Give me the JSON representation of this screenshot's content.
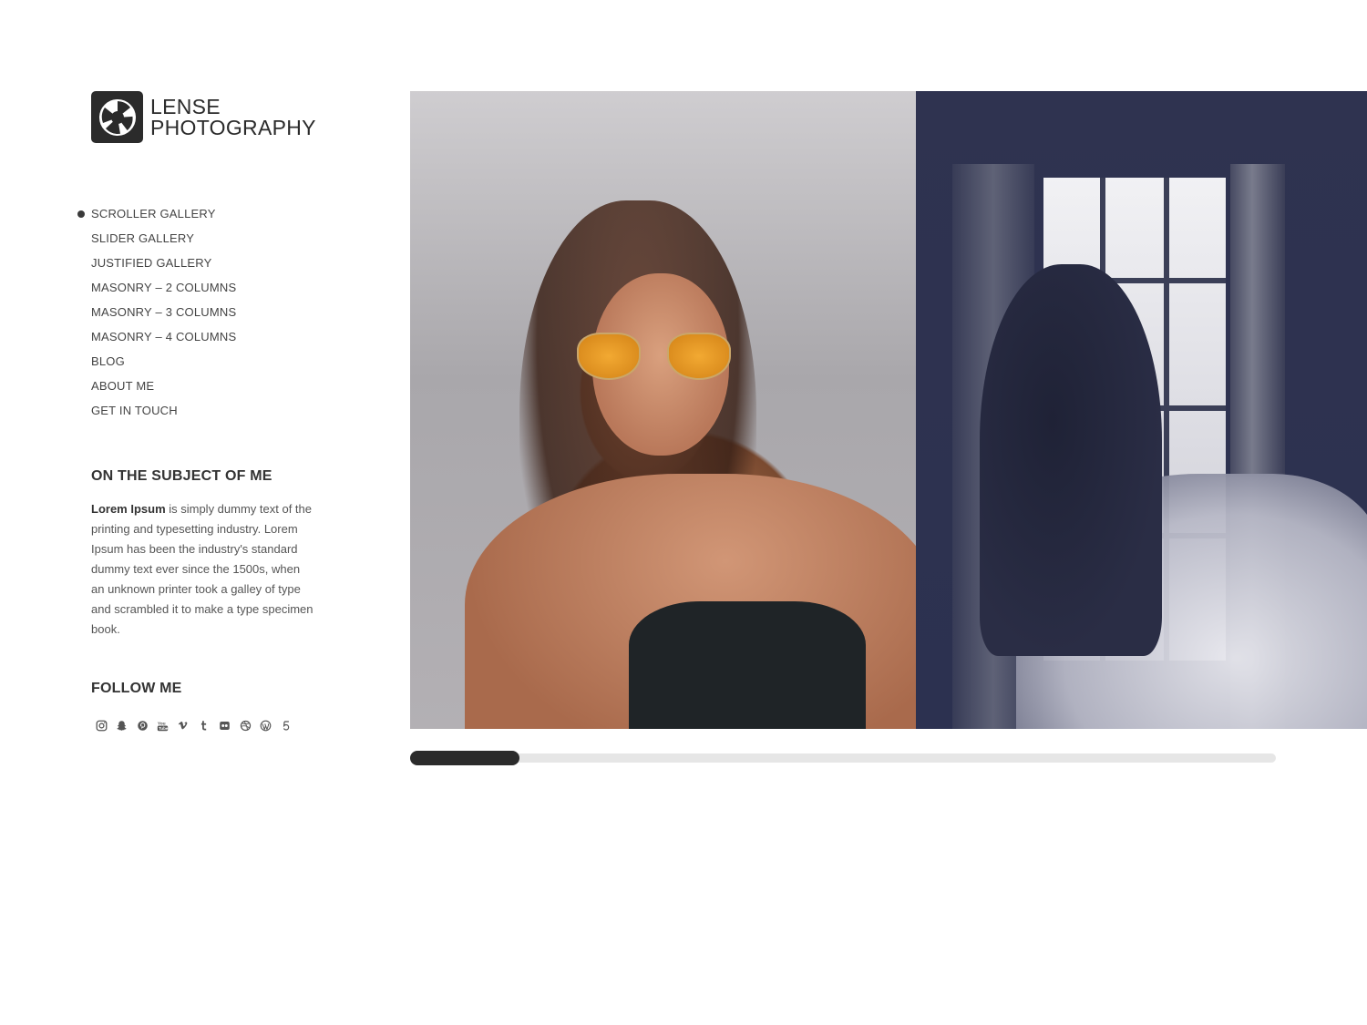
{
  "site": {
    "logo_line1": "LENSE",
    "logo_line2": "PHOTOGRAPHY",
    "logo_icon": "camera-aperture-icon"
  },
  "nav": {
    "items": [
      {
        "label": "SCROLLER GALLERY",
        "active": true
      },
      {
        "label": "SLIDER GALLERY",
        "active": false
      },
      {
        "label": "JUSTIFIED GALLERY",
        "active": false
      },
      {
        "label": "MASONRY – 2 COLUMNS",
        "active": false
      },
      {
        "label": "MASONRY – 3 COLUMNS",
        "active": false
      },
      {
        "label": "MASONRY – 4 COLUMNS",
        "active": false
      },
      {
        "label": "BLOG",
        "active": false
      },
      {
        "label": "ABOUT ME",
        "active": false
      },
      {
        "label": "GET IN TOUCH",
        "active": false
      }
    ]
  },
  "about": {
    "title": "ON THE SUBJECT OF ME",
    "text_bold": "Lorem Ipsum",
    "text_rest": " is simply dummy text of the printing and typesetting industry. Lorem Ipsum has been the industry's standard dummy text ever since the 1500s, when an unknown printer took a galley of type and scrambled it to make a type specimen book."
  },
  "follow": {
    "title": "FOLLOW ME",
    "icons": [
      "instagram-icon",
      "snapchat-icon",
      "pinterest-icon",
      "youtube-icon",
      "vimeo-icon",
      "tumblr-icon",
      "flickr-icon",
      "dribbble-icon",
      "wordpress-icon",
      "500px-icon"
    ]
  },
  "gallery": {
    "photos": [
      {
        "subject": "woman-orange-sunglasses-photo"
      },
      {
        "subject": "wedding-couple-window-photo"
      }
    ],
    "scroll_progress": 0.126
  },
  "colors": {
    "accent": "#2b2b2b",
    "track": "#e6e6e6"
  }
}
